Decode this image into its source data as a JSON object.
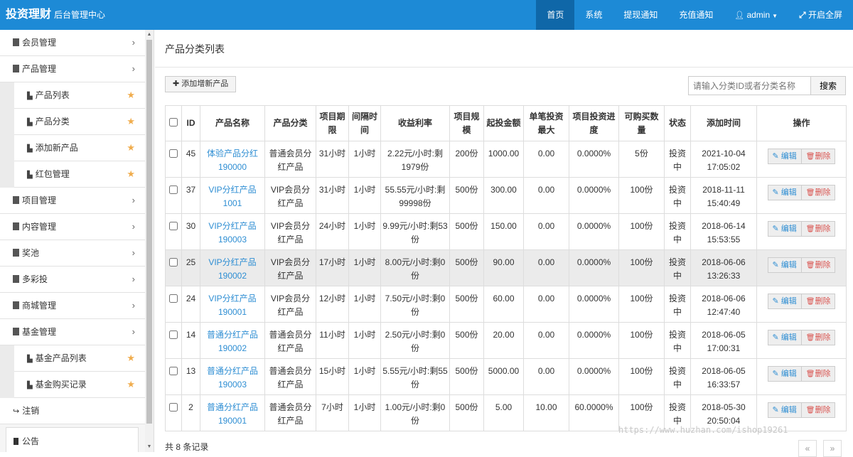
{
  "header": {
    "brand": "投资理财",
    "subtitle": "后台管理中心",
    "nav": [
      {
        "label": "首页",
        "active": true
      },
      {
        "label": "系统"
      },
      {
        "label": "提现通知"
      },
      {
        "label": "充值通知"
      },
      {
        "label": "admin",
        "icon": "user-icon",
        "caret": true
      },
      {
        "label": "开启全屏",
        "icon": "expand-icon"
      }
    ]
  },
  "sidebar": {
    "items": [
      {
        "label": "会员管理"
      },
      {
        "label": "产品管理",
        "children": [
          {
            "label": "产品列表"
          },
          {
            "label": "产品分类"
          },
          {
            "label": "添加新产品"
          },
          {
            "label": "红包管理"
          }
        ]
      },
      {
        "label": "项目管理"
      },
      {
        "label": "内容管理"
      },
      {
        "label": "奖池"
      },
      {
        "label": "多彩投"
      },
      {
        "label": "商城管理"
      },
      {
        "label": "基金管理",
        "children": [
          {
            "label": "基金产品列表"
          },
          {
            "label": "基金购买记录"
          }
        ]
      }
    ],
    "logout": "注销",
    "notice": "公告"
  },
  "main": {
    "title": "产品分类列表",
    "add_button": "添加增新产品",
    "search": {
      "placeholder": "请输入分类ID或者分类名称",
      "button": "搜索"
    },
    "columns": [
      "ID",
      "产品名称",
      "产品分类",
      "项目期限",
      "间隔时间",
      "收益利率",
      "项目规模",
      "起投金额",
      "单笔投资最大",
      "项目投资进度",
      "可购买数量",
      "状态",
      "添加时间",
      "操作"
    ],
    "actions": {
      "edit": "编辑",
      "delete": "删除"
    },
    "rows": [
      {
        "id": "45",
        "name": "体验产品分红190000",
        "category": "普通会员分红产品",
        "term": "31小时",
        "interval": "1小时",
        "rate": "2.22元/小时:剩1979份",
        "scale": "200份",
        "min": "1000.00",
        "max": "0.00",
        "progress": "0.0000%",
        "qty": "5份",
        "status": "投资中",
        "time": "2021-10-04 17:05:02"
      },
      {
        "id": "37",
        "name": "VIP分红产品1001",
        "category": "VIP会员分红产品",
        "term": "31小时",
        "interval": "1小时",
        "rate": "55.55元/小时:剩99998份",
        "scale": "500份",
        "min": "300.00",
        "max": "0.00",
        "progress": "0.0000%",
        "qty": "100份",
        "status": "投资中",
        "time": "2018-11-11 15:40:49"
      },
      {
        "id": "30",
        "name": "VIP分红产品190003",
        "category": "VIP会员分红产品",
        "term": "24小时",
        "interval": "1小时",
        "rate": "9.99元/小时:剩53份",
        "scale": "500份",
        "min": "150.00",
        "max": "0.00",
        "progress": "0.0000%",
        "qty": "100份",
        "status": "投资中",
        "time": "2018-06-14 15:53:55"
      },
      {
        "id": "25",
        "name": "VIP分红产品190002",
        "category": "VIP会员分红产品",
        "term": "17小时",
        "interval": "1小时",
        "rate": "8.00元/小时:剩0份",
        "scale": "500份",
        "min": "90.00",
        "max": "0.00",
        "progress": "0.0000%",
        "qty": "100份",
        "status": "投资中",
        "time": "2018-06-06 13:26:33",
        "highlight": true
      },
      {
        "id": "24",
        "name": "VIP分红产品190001",
        "category": "VIP会员分红产品",
        "term": "12小时",
        "interval": "1小时",
        "rate": "7.50元/小时:剩0份",
        "scale": "500份",
        "min": "60.00",
        "max": "0.00",
        "progress": "0.0000%",
        "qty": "100份",
        "status": "投资中",
        "time": "2018-06-06 12:47:40"
      },
      {
        "id": "14",
        "name": "普通分红产品190002",
        "category": "普通会员分红产品",
        "term": "11小时",
        "interval": "1小时",
        "rate": "2.50元/小时:剩0份",
        "scale": "500份",
        "min": "20.00",
        "max": "0.00",
        "progress": "0.0000%",
        "qty": "100份",
        "status": "投资中",
        "time": "2018-06-05 17:00:31"
      },
      {
        "id": "13",
        "name": "普通分红产品190003",
        "category": "普通会员分红产品",
        "term": "15小时",
        "interval": "1小时",
        "rate": "5.55元/小时:剩55份",
        "scale": "500份",
        "min": "5000.00",
        "max": "0.00",
        "progress": "0.0000%",
        "qty": "100份",
        "status": "投资中",
        "time": "2018-06-05 16:33:57"
      },
      {
        "id": "2",
        "name": "普通分红产品190001",
        "category": "普通会员分红产品",
        "term": "7小时",
        "interval": "1小时",
        "rate": "1.00元/小时:剩0份",
        "scale": "500份",
        "min": "5.00",
        "max": "10.00",
        "progress": "60.0000%",
        "qty": "100份",
        "status": "投资中",
        "time": "2018-05-30 20:50:04"
      }
    ],
    "footer": "共 8 条记录",
    "pager": {
      "prev": "«",
      "next": "»"
    }
  },
  "watermark": "https://www.huzhan.com/ishop19261"
}
